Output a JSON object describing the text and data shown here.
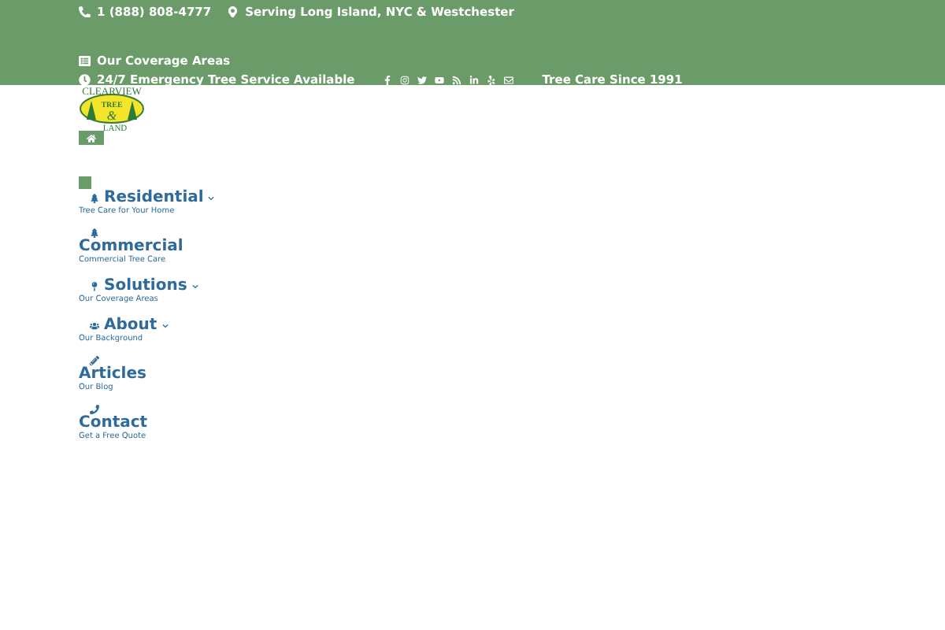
{
  "top_bar": {
    "phone": "1 (888) 808-4777",
    "location": "Serving Long Island, NYC & Westchester",
    "coverage_link": "Our Coverage Areas",
    "emergency": "24/7 Emergency Tree Service Available",
    "since": "Tree Care Since 1991"
  },
  "logo": {
    "line_1": "CLEARVIEW",
    "line_2": "TREE",
    "line_3": "&",
    "line_4": "LAND"
  },
  "nav": [
    {
      "label": "Residential",
      "subtitle": "Tree Care for Your Home",
      "kind": "inline",
      "dropdown": true
    },
    {
      "label": "Commercial",
      "subtitle": "Commercial Tree Care",
      "kind": "stacked",
      "dropdown": false
    },
    {
      "label": "Solutions",
      "subtitle": "Our Coverage Areas",
      "kind": "inline",
      "dropdown": true
    },
    {
      "label": "About",
      "subtitle": "Our Background",
      "kind": "inline",
      "dropdown": true
    },
    {
      "label": "Articles",
      "subtitle": "Our Blog",
      "kind": "stacked",
      "dropdown": false
    },
    {
      "label": "Contact",
      "subtitle": "Get a Free Quote",
      "kind": "stacked",
      "dropdown": false
    }
  ]
}
